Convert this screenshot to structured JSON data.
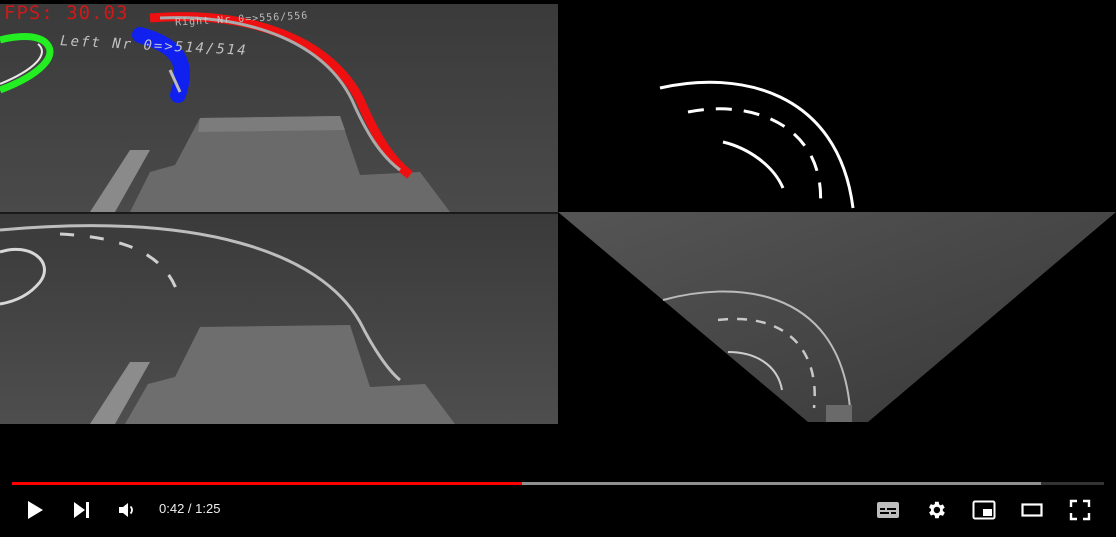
{
  "video": {
    "overlay_fps": "FPS: 30.03",
    "overlay_right": "Right Nr 0=>556/556",
    "overlay_left": "Left Nr 0=>514/514"
  },
  "player": {
    "progress_fraction": 0.4667,
    "buffered_fraction": 0.942,
    "accent_color": "#ff0000",
    "time_current": "0:42",
    "time_separator": " / ",
    "time_total": "1:25",
    "icons": [
      "play-icon",
      "next-icon",
      "volume-icon",
      "subtitles-icon",
      "settings-icon",
      "miniplayer-icon",
      "theater-icon",
      "fullscreen-icon"
    ]
  }
}
